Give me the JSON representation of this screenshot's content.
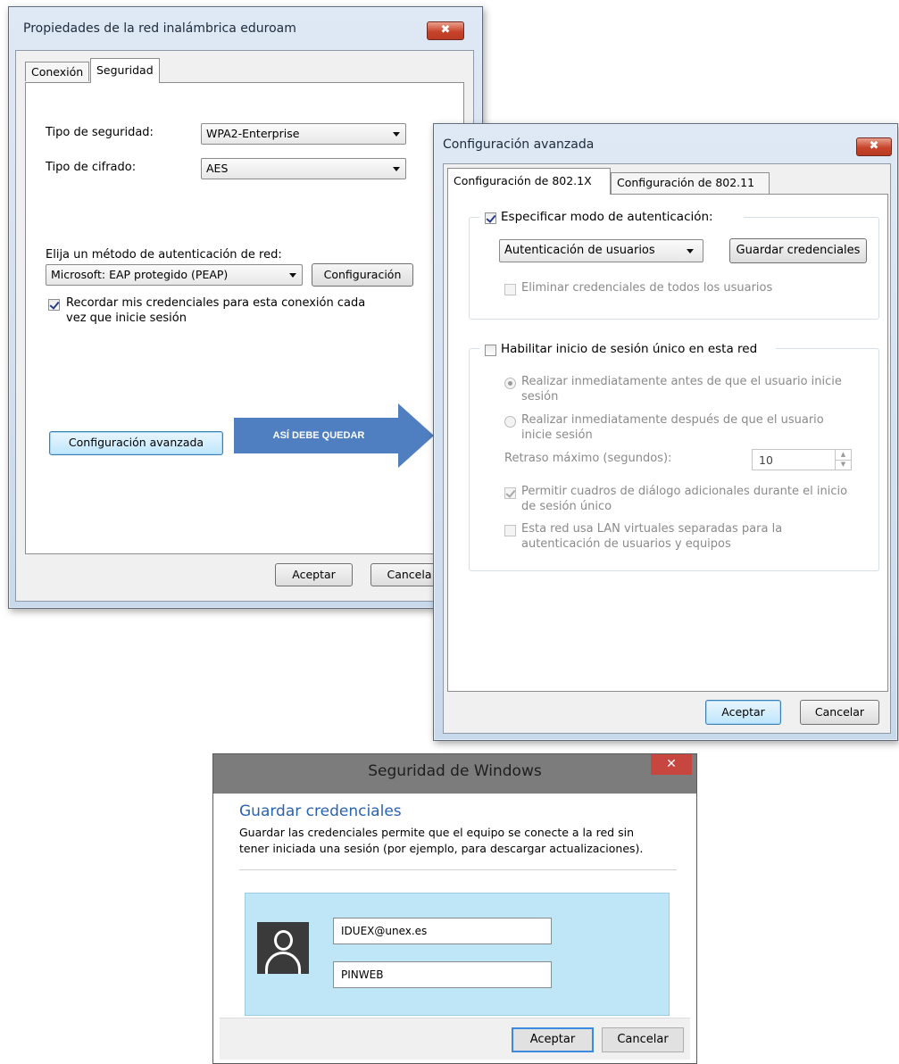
{
  "props_window": {
    "title": "Propiedades de la red inalámbrica eduroam",
    "close": "✖",
    "tabs": [
      "Conexión",
      "Seguridad"
    ],
    "security_type_label": "Tipo de seguridad:",
    "security_type_value": "WPA2-Enterprise",
    "encryption_label": "Tipo de cifrado:",
    "encryption_value": "AES",
    "auth_method_label": "Elija un método de autenticación de red:",
    "auth_method_value": "Microsoft: EAP protegido (PEAP)",
    "config_button": "Configuración",
    "remember_line1": "Recordar mis credenciales para esta conexión cada",
    "remember_line2": "vez que inicie sesión",
    "advanced_button": "Configuración avanzada",
    "ok_button": "Aceptar",
    "cancel_button": "Cancela"
  },
  "arrow_banner": {
    "text": "ASÍ DEBE QUEDAR",
    "color": "#4f7fc0"
  },
  "advanced_window": {
    "title": "Configuración avanzada",
    "close": "✖",
    "tabs": [
      "Configuración de 802.1X",
      "Configuración de 802.11"
    ],
    "specify_auth_label": "Especificar modo de autenticación:",
    "auth_mode_value": "Autenticación de usuarios",
    "save_credentials_button": "Guardar credenciales",
    "delete_credentials_label": "Eliminar credenciales de todos los usuarios",
    "sso_label": "Habilitar inicio de sesión único en esta red",
    "before_logon_line1": "Realizar inmediatamente antes de que el usuario inicie",
    "before_logon_line2": "sesión",
    "after_logon_line1": "Realizar inmediatamente después de que el usuario",
    "after_logon_line2": "inicie sesión",
    "max_delay_label": "Retraso máximo (segundos):",
    "max_delay_value": "10",
    "allow_dialogs_line1": "Permitir cuadros de diálogo adicionales durante el inicio",
    "allow_dialogs_line2": "de sesión único",
    "vlan_line1": "Esta red usa LAN virtuales separadas para la",
    "vlan_line2": "autenticación de usuarios y equipos",
    "ok_button": "Aceptar",
    "cancel_button": "Cancelar"
  },
  "security_dialog": {
    "title": "Seguridad de Windows",
    "close": "✕",
    "heading": "Guardar credenciales",
    "desc_line1": "Guardar las credenciales permite que el equipo se conecte a la red sin",
    "desc_line2": "tener iniciada una sesión (por ejemplo, para descargar actualizaciones).",
    "username": "IDUEX@unex.es",
    "password": "PINWEB",
    "ok_button": "Aceptar",
    "cancel_button": "Cancelar",
    "accent_color": "#2a63ad",
    "panel_color": "#bfe6f7"
  }
}
